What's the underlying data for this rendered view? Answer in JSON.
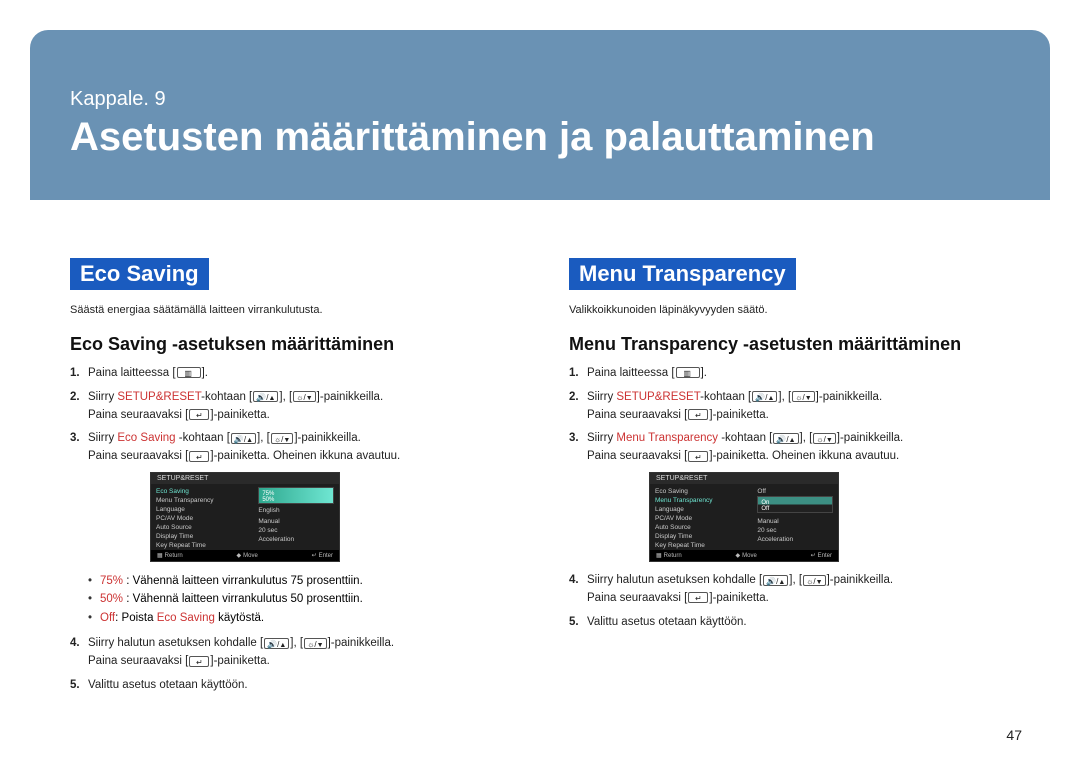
{
  "chapter": {
    "label": "Kappale. 9",
    "title": "Asetusten määrittäminen ja palauttaminen"
  },
  "page_number": "47",
  "eco": {
    "title": "Eco Saving",
    "intro": "Säästä energiaa säätämällä laitteen virrankulutusta.",
    "sub": "Eco Saving -asetuksen määrittäminen",
    "s1_a": "Paina laitteessa [",
    "s1_b": "].",
    "s2_a": "Siirry ",
    "s2_kw": "SETUP&RESET",
    "s2_b": "-kohtaan [",
    "s2_c": "], [",
    "s2_d": "]-painikkeilla.",
    "s2_e": "Paina seuraavaksi [",
    "s2_f": "]-painiketta.",
    "s3_a": "Siirry ",
    "s3_kw": "Eco Saving",
    "s3_b": " -kohtaan [",
    "s3_c": "], [",
    "s3_d": "]-painikkeilla.",
    "s3_e": "Paina seuraavaksi [",
    "s3_f": "]-painiketta. Oheinen ikkuna avautuu.",
    "b1_kw": "75%",
    "b1_t": " : Vähennä laitteen virrankulutus 75 prosenttiin.",
    "b2_kw": "50%",
    "b2_t": " : Vähennä laitteen virrankulutus 50 prosenttiin.",
    "b3_kw": "Off",
    "b3_t": ": Poista ",
    "b3_kw2": "Eco Saving",
    "b3_t2": " käytöstä.",
    "s4_a": "Siirry halutun asetuksen kohdalle [",
    "s4_b": "], [",
    "s4_c": "]-painikkeilla.",
    "s4_d": "Paina seuraavaksi [",
    "s4_e": "]-painiketta.",
    "s5": "Valittu asetus otetaan käyttöön.",
    "osd": {
      "title": "SETUP&RESET",
      "rows_left": [
        "Eco Saving",
        "Menu Transparency",
        "Language",
        "PC/AV Mode",
        "Auto Source",
        "Display Time",
        "Key Repeat Time"
      ],
      "rows_right": [
        "",
        "",
        "English",
        "",
        "Manual",
        "20 sec",
        "Acceleration"
      ],
      "hl_index": 0,
      "preview_top": "75%",
      "preview_bot": "50%",
      "footer": [
        "Return",
        "Move",
        "Enter"
      ]
    }
  },
  "menu": {
    "title": "Menu Transparency",
    "intro": "Valikkoikkunoiden läpinäkyvyyden säätö.",
    "sub": "Menu Transparency -asetusten määrittäminen",
    "s3_kw": "Menu Transparency",
    "s4_a": "Siirry halutun asetuksen kohdalle [",
    "s4_b": "], [",
    "s4_c": "]-painikkeilla.",
    "s4_d": "Paina seuraavaksi [",
    "s4_e": "]-painiketta.",
    "s5": "Valittu asetus otetaan käyttöön.",
    "osd": {
      "title": "SETUP&RESET",
      "rows_left": [
        "Eco Saving",
        "Menu Transparency",
        "Language",
        "PC/AV Mode",
        "Auto Source",
        "Display Time",
        "Key Repeat Time"
      ],
      "rows_right": [
        "Off",
        "",
        "English",
        "",
        "Manual",
        "20 sec",
        "Acceleration"
      ],
      "hl_index": 1,
      "preview_top": "On",
      "preview_bot": "Off",
      "footer": [
        "Return",
        "Move",
        "Enter"
      ]
    }
  },
  "icons": {
    "menu_btn": "▥",
    "enter_btn": "↵",
    "vol_up": "🔊/",
    "bright": "☼/"
  }
}
